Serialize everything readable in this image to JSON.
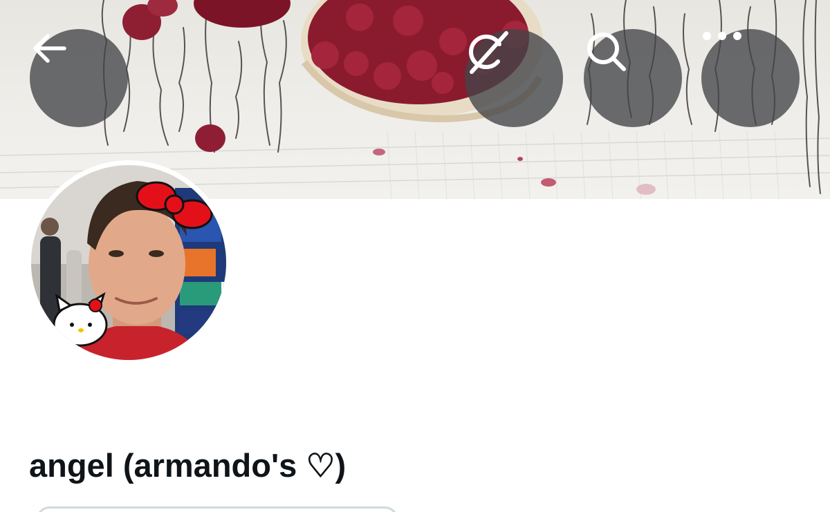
{
  "header": {
    "back_icon": "arrow-left-icon",
    "grok_icon": "grok-icon",
    "search_icon": "search-icon",
    "more_icon": "more-horizontal-icon"
  },
  "banner": {
    "description_colors": {
      "paper": "#eceae5",
      "pomegranate": "#7a1228",
      "ink": "#3a3535"
    }
  },
  "profile": {
    "display_name": "angel (armando's ♡)"
  },
  "colors": {
    "button_overlay": "#424448",
    "text_primary": "#0f1419",
    "border": "#cfd9de"
  }
}
